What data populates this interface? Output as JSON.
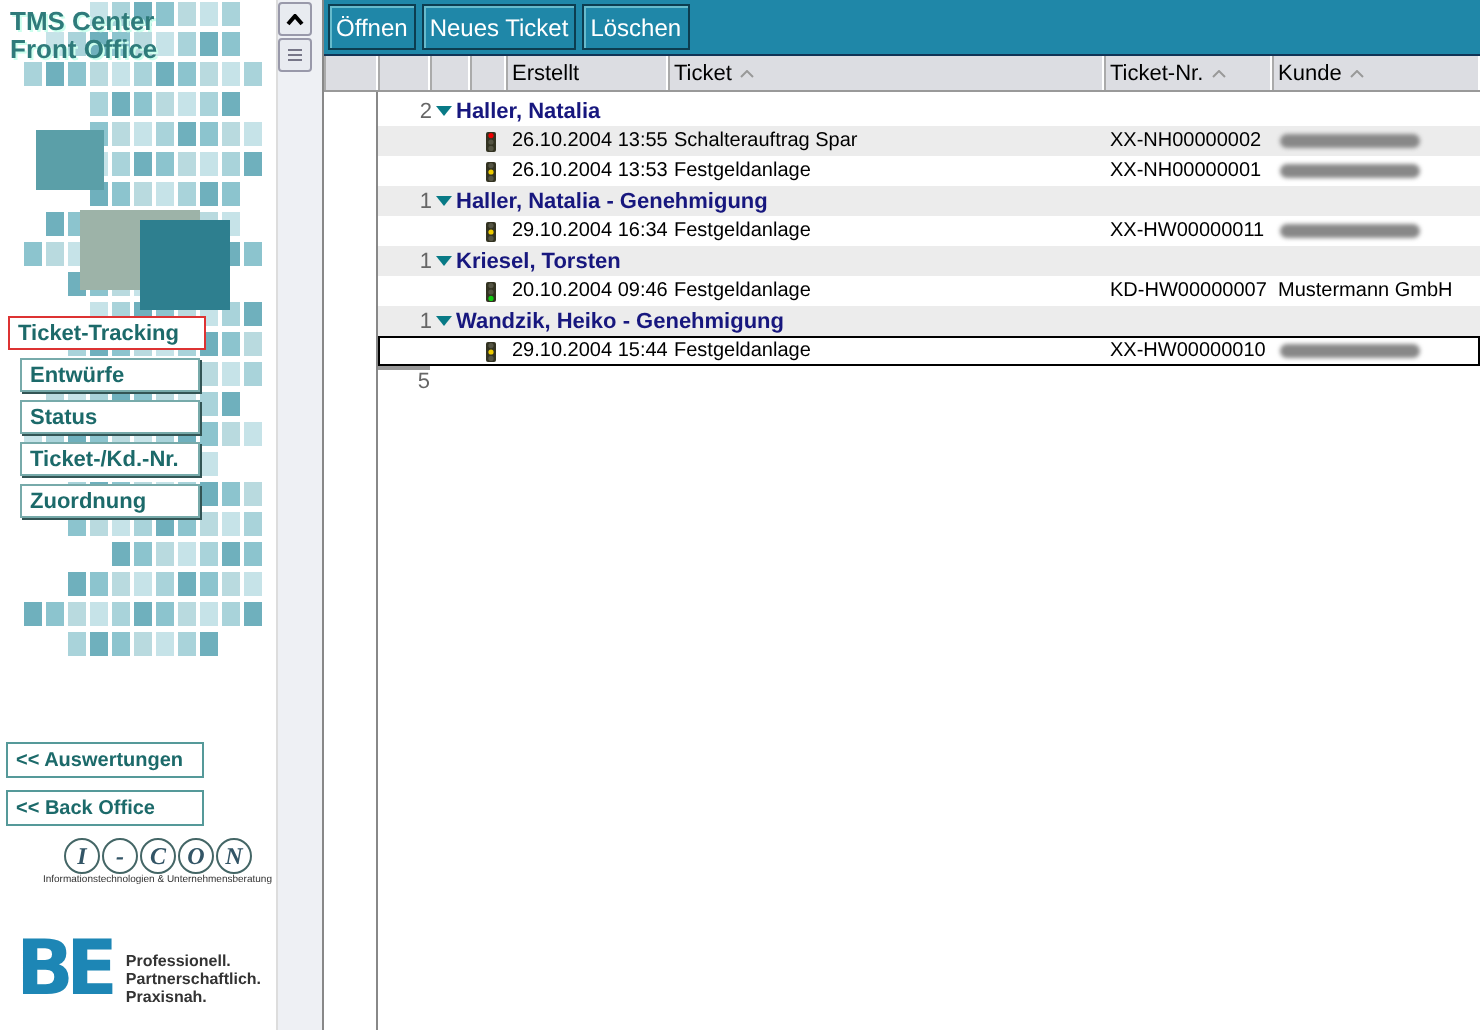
{
  "sidebar": {
    "title": [
      "TMS Center",
      "Front Office"
    ],
    "nav": [
      {
        "label": "Ticket-Tracking",
        "kind": "section",
        "selected": true
      },
      {
        "label": "Entwürfe",
        "kind": "sub",
        "selected": false
      },
      {
        "label": "Status",
        "kind": "sub",
        "selected": false
      },
      {
        "label": "Ticket-/Kd.-Nr.",
        "kind": "sub",
        "selected": false
      },
      {
        "label": "Zuordnung",
        "kind": "sub",
        "selected": false
      }
    ],
    "links": [
      "<< Auswertungen",
      "<< Back Office"
    ],
    "icon_logo": {
      "letters": [
        "I",
        "-",
        "C",
        "O",
        "N"
      ],
      "tagline": "Informationstechnologien & Unternehmensberatung"
    },
    "be_logo": {
      "mark": "BE",
      "slogan": [
        "Professionell.",
        "Partnerschaftlich.",
        "Praxisnah."
      ]
    }
  },
  "toolbar": {
    "buttons": [
      "Öffnen",
      "Neues Ticket",
      "Löschen"
    ]
  },
  "table": {
    "columns": [
      {
        "label": "Erstellt",
        "sorted": false
      },
      {
        "label": "Ticket",
        "sorted": true
      },
      {
        "label": "Ticket-Nr.",
        "sorted": true
      },
      {
        "label": "Kunde",
        "sorted": true
      }
    ],
    "groups": [
      {
        "count": "2",
        "name": "Haller, Natalia",
        "expanded": true,
        "tickets": [
          {
            "color": "#ee0000",
            "created": "26.10.2004 13:55",
            "ticket": "Schalterauftrag Spar",
            "ticket_no": "XX-NH00000002",
            "customer_redacted": true,
            "selected": false
          },
          {
            "color": "#eecc00",
            "created": "26.10.2004 13:53",
            "ticket": "Festgeldanlage",
            "ticket_no": "XX-NH00000001",
            "customer_redacted": true,
            "selected": false
          }
        ]
      },
      {
        "count": "1",
        "name": "Haller, Natalia - Genehmigung",
        "expanded": true,
        "tickets": [
          {
            "color": "#eecc00",
            "created": "29.10.2004 16:34",
            "ticket": "Festgeldanlage",
            "ticket_no": "XX-HW00000011",
            "customer_redacted": true,
            "selected": false
          }
        ]
      },
      {
        "count": "1",
        "name": "Kriesel, Torsten",
        "expanded": true,
        "tickets": [
          {
            "color": "#11cc11",
            "created": "20.10.2004 09:46",
            "ticket": "Festgeldanlage",
            "ticket_no": "KD-HW00000007",
            "customer": "Mustermann GmbH",
            "customer_redacted": false,
            "selected": false
          }
        ]
      },
      {
        "count": "1",
        "name": "Wandzik, Heiko - Genehmigung",
        "expanded": true,
        "tickets": [
          {
            "color": "#eecc00",
            "created": "29.10.2004 15:44",
            "ticket": "Festgeldanlage",
            "ticket_no": "XX-HW00000010",
            "customer_redacted": true,
            "selected": true
          }
        ]
      }
    ],
    "total": "5"
  }
}
